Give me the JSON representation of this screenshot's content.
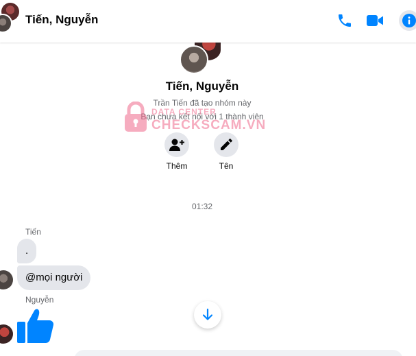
{
  "header": {
    "title": "Tiến, Nguyễn",
    "icons": [
      "phone-icon",
      "video-camera-icon",
      "info-icon"
    ],
    "accent_color": "#0084ff"
  },
  "intro": {
    "name": "Tiến, Nguyễn",
    "created_text": "Trần Tiến đã tạo nhóm này",
    "connection_text": "Bạn chưa kết nối với 1 thành viên",
    "actions": [
      {
        "label": "Thêm",
        "icon": "add-person-icon"
      },
      {
        "label": "Tên",
        "icon": "pencil-icon"
      }
    ]
  },
  "watermark": {
    "small_text": "DATA CENTER",
    "big_text": "CHECKSCAM.VN",
    "color": "#f06a8c"
  },
  "conversation": {
    "timestamp": "01:32",
    "groups": [
      {
        "sender": "Tiến",
        "messages": [
          ".",
          "@mọi người"
        ]
      },
      {
        "sender": "Nguyễn",
        "messages": [
          "thumbs-up-like"
        ]
      }
    ]
  }
}
